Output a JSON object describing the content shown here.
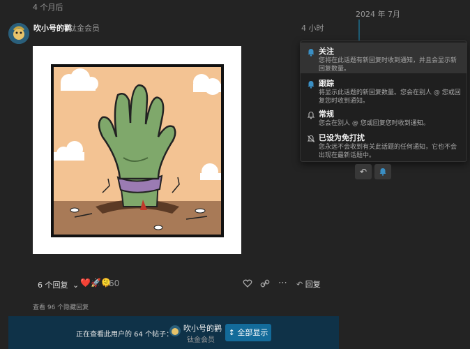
{
  "header": {
    "time_ago": "4 个月后",
    "timeline_date": "2024 年 7月"
  },
  "post": {
    "author": "吹小号的鹳",
    "badge": "钛金会员",
    "time": "4 小时",
    "replies_label": "6 个回复",
    "reactions_emoji": "❤️🚀🫠",
    "reactions_count": "60",
    "reply_label": "回复",
    "hidden_replies": "查看 96 个隐藏回复"
  },
  "notification_menu": {
    "items": [
      {
        "title": "关注",
        "desc": "您将在此话题有新回复时收到通知，并且会显示新回复数量。",
        "icon": "bell-icon"
      },
      {
        "title": "跟踪",
        "desc": "将显示此话题的新回复数量。您会在别人 @ 您或回复您时收到通知。",
        "icon": "bell-icon"
      },
      {
        "title": "常规",
        "desc": "您会在别人 @ 您或回复您时收到通知。",
        "icon": "bell-outline-icon"
      },
      {
        "title": "已设为免打扰",
        "desc": "您永远不会收到有关此话题的任何通知，它也不会出现在最新话题中。",
        "icon": "bell-slash-icon"
      }
    ]
  },
  "bottom_bar": {
    "viewing_text": "正在查看此用户的 64 个帖子：",
    "user_name": "吹小号的鹳",
    "user_badge": "钛金会员",
    "show_all": "全部显示"
  },
  "colors": {
    "accent": "#136b9a",
    "menu_bg": "#1f1f1f",
    "bottom_bar": "#0f3248"
  }
}
